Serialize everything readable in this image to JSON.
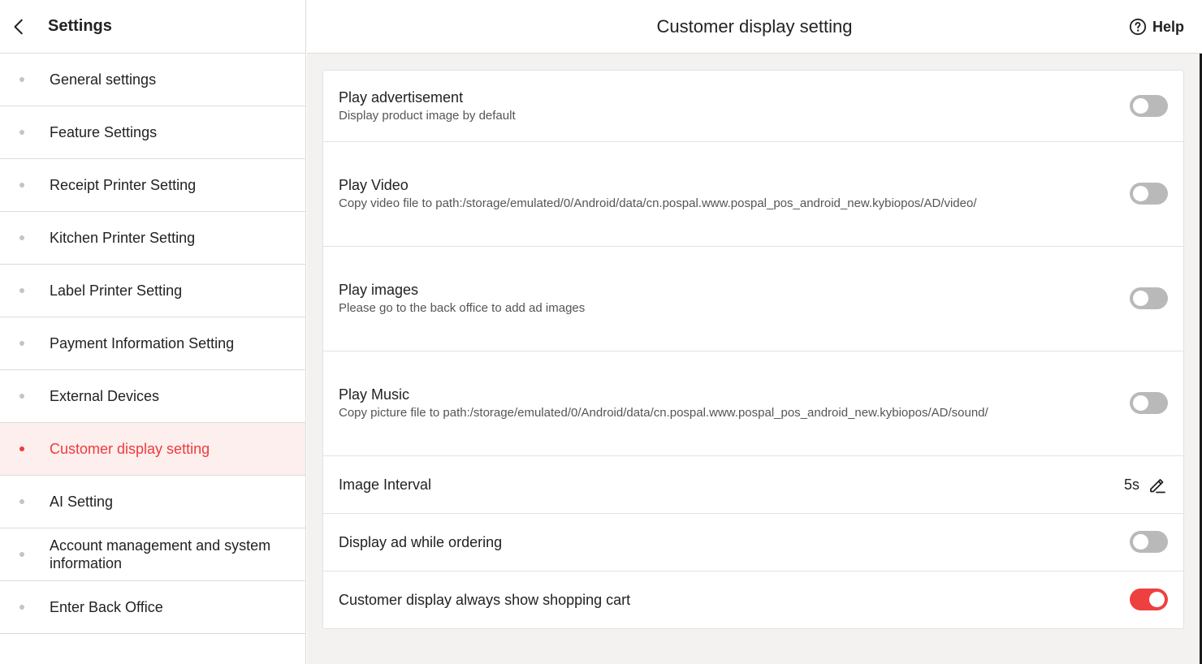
{
  "sidebar": {
    "title": "Settings",
    "items": [
      {
        "label": "General settings",
        "active": false
      },
      {
        "label": "Feature Settings",
        "active": false
      },
      {
        "label": "Receipt Printer Setting",
        "active": false
      },
      {
        "label": "Kitchen Printer Setting",
        "active": false
      },
      {
        "label": "Label Printer Setting",
        "active": false
      },
      {
        "label": "Payment Information Setting",
        "active": false
      },
      {
        "label": "External Devices",
        "active": false
      },
      {
        "label": "Customer display setting",
        "active": true
      },
      {
        "label": "AI Setting",
        "active": false
      },
      {
        "label": "Account management and system information",
        "active": false
      },
      {
        "label": "Enter Back Office",
        "active": false
      }
    ]
  },
  "header": {
    "title": "Customer display setting",
    "help_label": "Help"
  },
  "settings": {
    "play_ad": {
      "title": "Play advertisement",
      "subtitle": "Display product image by default",
      "enabled": false
    },
    "play_video": {
      "title": "Play Video",
      "subtitle": "Copy video file to path:/storage/emulated/0/Android/data/cn.pospal.www.pospal_pos_android_new.kybiopos/AD/video/",
      "enabled": false
    },
    "play_images": {
      "title": "Play images",
      "subtitle": "Please go to the back office to add ad images",
      "enabled": false
    },
    "play_music": {
      "title": "Play Music",
      "subtitle": "Copy picture file to path:/storage/emulated/0/Android/data/cn.pospal.www.pospal_pos_android_new.kybiopos/AD/sound/",
      "enabled": false
    },
    "image_interval": {
      "title": "Image Interval",
      "value": "5s"
    },
    "display_ad_ordering": {
      "title": "Display ad while ordering",
      "enabled": false
    },
    "always_show_cart": {
      "title": "Customer display always show shopping cart",
      "enabled": true
    }
  },
  "colors": {
    "accent": "#ee3b3b",
    "toggle_off": "#b9b9b9",
    "active_bg": "#fcefee",
    "main_bg": "#f4f2f1"
  },
  "icons": {
    "back": "chevron-left-icon",
    "help": "question-circle-icon",
    "edit": "pencil-icon"
  }
}
